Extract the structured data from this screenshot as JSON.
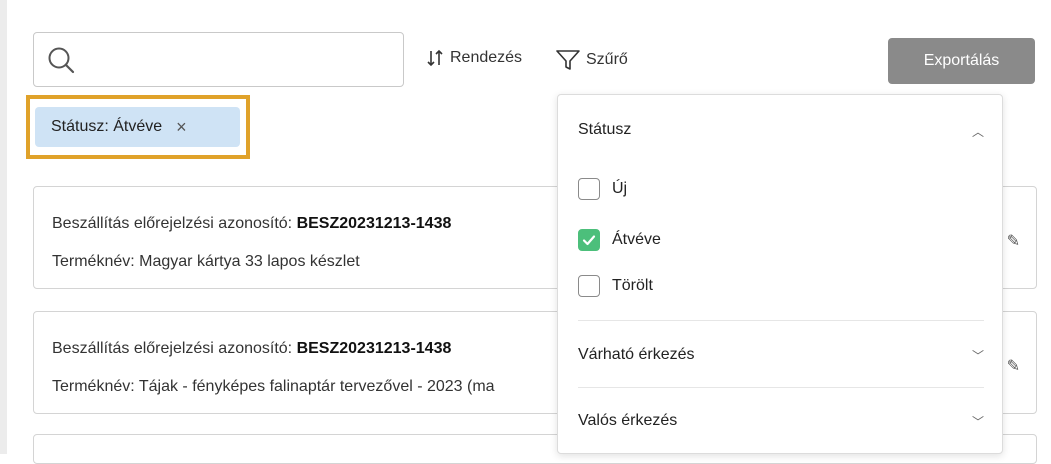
{
  "search": {
    "placeholder": ""
  },
  "toolbar": {
    "sort_label": "Rendezés",
    "filter_label": "Szűrő",
    "export_label": "Exportálás"
  },
  "active_filter": {
    "label": "Státusz: Átvéve",
    "remove_icon": "×"
  },
  "cards": [
    {
      "id_label": "Beszállítás előrejelzési azonosító: ",
      "id_value": "BESZ20231213-1438",
      "product": "Terméknév: Magyar kártya 33 lapos készlet"
    },
    {
      "id_label": "Beszállítás előrejelzési azonosító: ",
      "id_value": "BESZ20231213-1438",
      "product": "Terméknév: Tájak - fényképes falinaptár tervezővel - 2023 (ma"
    }
  ],
  "filter_panel": {
    "status": {
      "title": "Státusz",
      "options": [
        {
          "label": "Új",
          "checked": false
        },
        {
          "label": "Átvéve",
          "checked": true
        },
        {
          "label": "Törölt",
          "checked": false
        }
      ]
    },
    "expected_arrival": {
      "title": "Várható érkezés"
    },
    "actual_arrival": {
      "title": "Valós érkezés"
    }
  },
  "colors": {
    "accent_highlight": "#e0a22a",
    "chip_bg": "#cfe3f5",
    "check_green": "#4cbf7b",
    "export_bg": "#8a8a8a"
  }
}
